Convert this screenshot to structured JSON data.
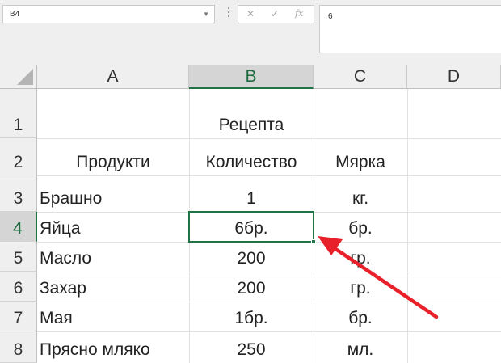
{
  "formula_bar": {
    "name_box": "B4",
    "cancel_glyph": "✕",
    "enter_glyph": "✓",
    "fx_glyph": "fx",
    "formula_value": "6"
  },
  "columns": [
    {
      "label": "A",
      "selected": false
    },
    {
      "label": "B",
      "selected": true
    },
    {
      "label": "C",
      "selected": false
    },
    {
      "label": "D",
      "selected": false
    }
  ],
  "rows": [
    {
      "label": "1",
      "selected": false
    },
    {
      "label": "2",
      "selected": false
    },
    {
      "label": "3",
      "selected": false
    },
    {
      "label": "4",
      "selected": true
    },
    {
      "label": "5",
      "selected": false
    },
    {
      "label": "6",
      "selected": false
    },
    {
      "label": "7",
      "selected": false
    },
    {
      "label": "8",
      "selected": false
    }
  ],
  "sheet": {
    "title": "Рецепта",
    "headers": [
      "Продукти",
      "Количество",
      "Мярка"
    ],
    "data": [
      [
        "Брашно",
        "1",
        "кг."
      ],
      [
        "Яйца",
        "6бр.",
        "бр."
      ],
      [
        "Масло",
        "200",
        "гр."
      ],
      [
        "Захар",
        "200",
        "гр."
      ],
      [
        "Мая",
        "1бр.",
        "бр."
      ],
      [
        "Прясно мляко",
        "250",
        "мл."
      ]
    ]
  },
  "selected_cell": "B4",
  "colors": {
    "excel_green": "#217346",
    "annotation_arrow": "#e8202a"
  }
}
